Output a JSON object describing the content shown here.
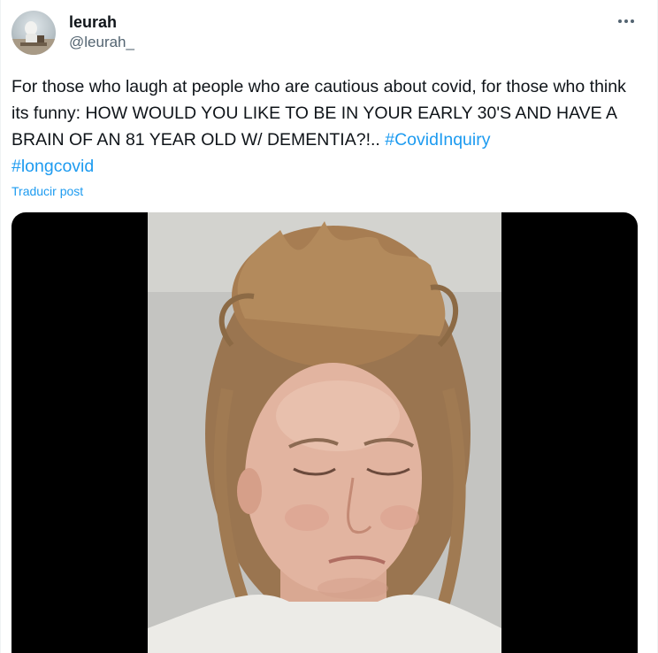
{
  "user": {
    "display_name": "leurah",
    "handle": "@leurah_",
    "avatar_icon": "profile-avatar-icon"
  },
  "menu": {
    "more_icon": "more-dots-icon"
  },
  "tweet": {
    "text_plain": "For those who laugh at people who are cautious about covid, for those who think its funny: HOW WOULD YOU LIKE TO BE IN YOUR EARLY 30'S AND HAVE A BRAIN OF AN 81 YEAR OLD W/ DEMENTIA?!.. ",
    "hashtags": [
      "#CovidInquiry",
      "#longcovid"
    ],
    "translate_label": "Traducir post"
  },
  "colors": {
    "link": "#1d9bf0",
    "text": "#0f1419",
    "secondary": "#536471",
    "media_background": "#000000"
  }
}
